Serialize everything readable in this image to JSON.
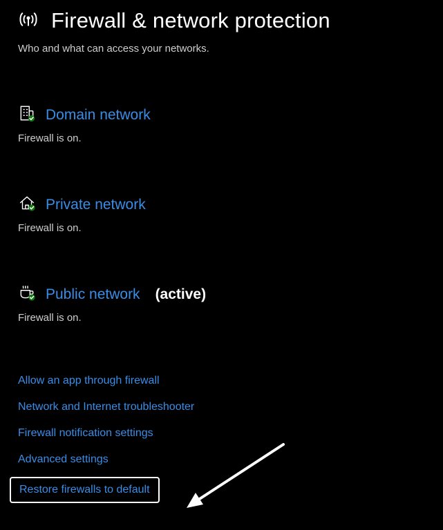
{
  "header": {
    "title": "Firewall & network protection",
    "subtitle": "Who and what can access your networks."
  },
  "networks": {
    "domain": {
      "label": "Domain network",
      "status": "Firewall is on."
    },
    "private": {
      "label": "Private network",
      "status": "Firewall is on."
    },
    "public": {
      "label": "Public network",
      "active_suffix": "(active)",
      "status": "Firewall is on."
    }
  },
  "links": {
    "allow_app": "Allow an app through firewall",
    "troubleshooter": "Network and Internet troubleshooter",
    "notifications": "Firewall notification settings",
    "advanced": "Advanced settings",
    "restore": "Restore firewalls to default"
  }
}
